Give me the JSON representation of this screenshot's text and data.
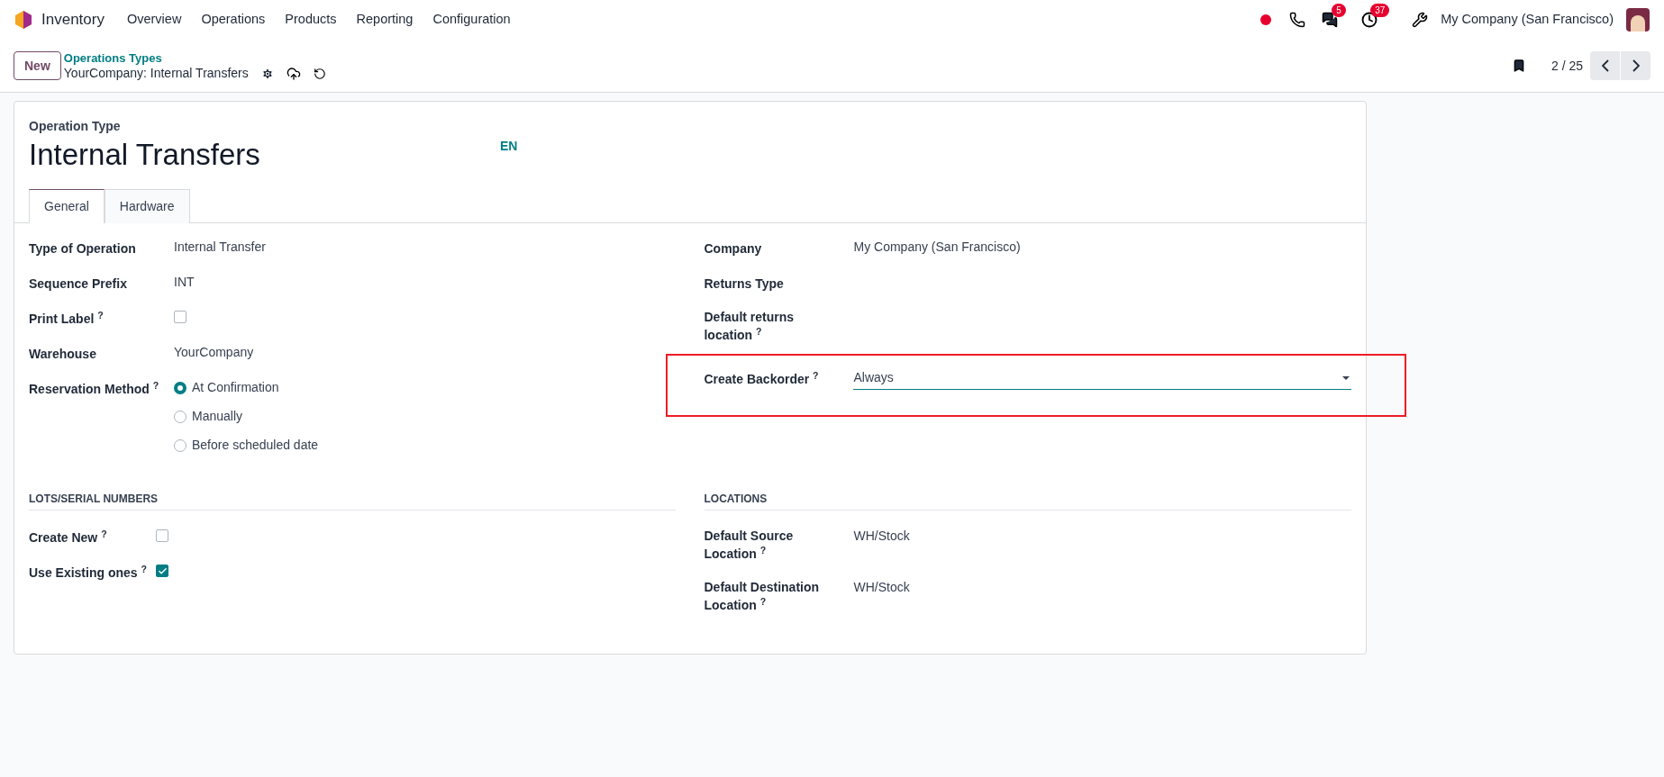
{
  "navbar": {
    "app": "Inventory",
    "menu": [
      "Overview",
      "Operations",
      "Products",
      "Reporting",
      "Configuration"
    ],
    "chat_badge": "5",
    "activity_badge": "37",
    "company": "My Company (San Francisco)"
  },
  "control_panel": {
    "new_button": "New",
    "breadcrumb": "Operations Types",
    "record": "YourCompany: Internal Transfers",
    "pager": "2 / 25"
  },
  "form": {
    "caption": "Operation Type",
    "title": "Internal Transfers",
    "lang": "EN",
    "tabs": [
      {
        "label": "General",
        "selected": true
      },
      {
        "label": "Hardware",
        "selected": false
      }
    ],
    "left_fields": [
      {
        "kind": "text",
        "label": "Type of Operation",
        "value": "Internal Transfer"
      },
      {
        "kind": "text",
        "label": "Sequence Prefix",
        "value": "INT"
      },
      {
        "kind": "checkbox",
        "label": "Print Label $^{?}$",
        "checked": false
      },
      {
        "kind": "text",
        "label": "Warehouse",
        "value": "YourCompany"
      },
      {
        "kind": "radio",
        "label": "Reservation Method $^{?}$",
        "options": [
          {
            "label": "At Confirmation",
            "selected": true
          },
          {
            "label": "Manually",
            "selected": false
          },
          {
            "label": "Before scheduled date",
            "selected": false
          }
        ]
      }
    ],
    "right_fields": [
      {
        "kind": "text",
        "label": "Company",
        "value": "My Company (San Francisco)"
      },
      {
        "kind": "text",
        "label": "Returns Type"
      },
      {
        "kind": "text",
        "label": "Default returns location $^{?}$"
      },
      {
        "kind": "select",
        "label": "Create Backorder $^{?}$",
        "value": "Always",
        "highlighted": true
      }
    ],
    "sections": [
      {
        "title": "LOTS/SERIAL NUMBERS",
        "fields": [
          {
            "kind": "checkbox",
            "label": "Create New $^{?}$",
            "checked": false
          },
          {
            "kind": "checkbox",
            "label": "Use Existing ones $^{?}$",
            "checked": true
          }
        ]
      },
      {
        "title": "LOCATIONS",
        "fields": [
          {
            "kind": "text",
            "label": "Default Source Location $^{?}$",
            "value": "WH/Stock"
          },
          {
            "kind": "text",
            "label": "Default Destination Location $^{?}$",
            "value": "WH/Stock"
          }
        ]
      }
    ]
  }
}
